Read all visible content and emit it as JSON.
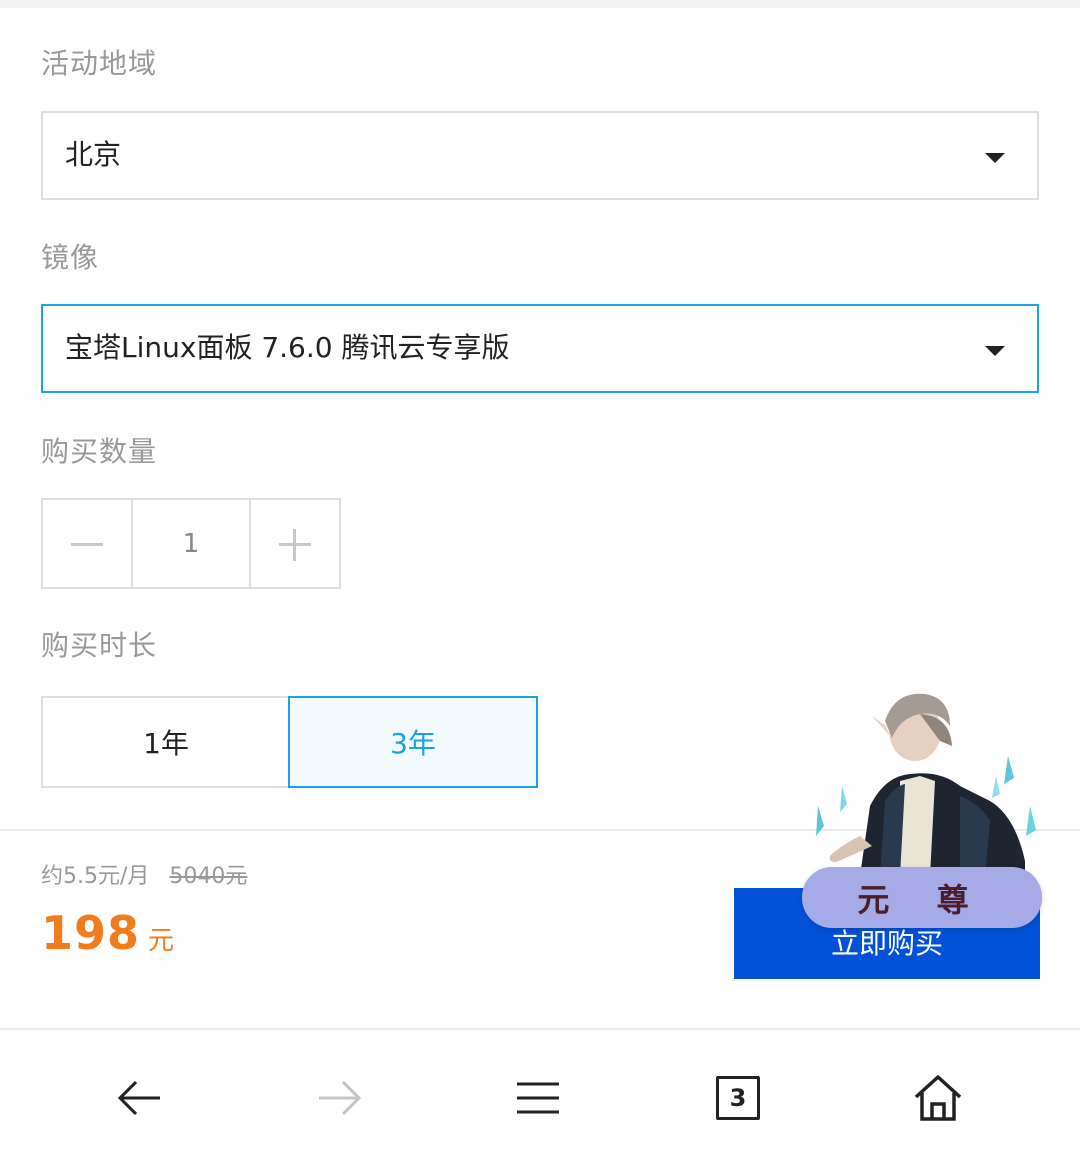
{
  "form": {
    "region_label": "活动地域",
    "region_value": "北京",
    "image_label": "镜像",
    "image_value": "宝塔Linux面板 7.6.0 腾讯云专享版",
    "quantity_label": "购买数量",
    "quantity_value": "1",
    "duration_label": "购买时长",
    "duration_options": [
      "1年",
      "3年"
    ],
    "duration_selected": "3年"
  },
  "footer": {
    "monthly": "约5.5元/月",
    "original_price": "5040元",
    "price": "198",
    "price_unit": "元",
    "buy_label": "立即购买"
  },
  "overlay": {
    "badge_text": "元 尊"
  },
  "nav": {
    "tab_count": "3",
    "icons": [
      "back-arrow-icon",
      "forward-arrow-icon",
      "menu-icon",
      "tabs-icon",
      "home-icon"
    ]
  },
  "colors": {
    "accent": "#1aa3e0",
    "price": "#f27c1b",
    "buy_button": "#0252d9",
    "label": "#999999",
    "border": "#dedede"
  }
}
